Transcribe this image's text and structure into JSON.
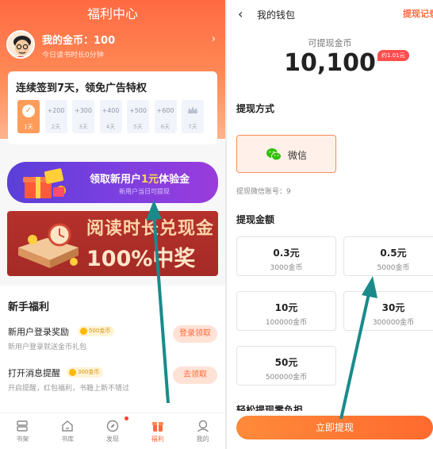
{
  "left": {
    "title": "福利中心",
    "user": {
      "coins_label": "我的金币：100",
      "read_time": "今日读书时长0分钟"
    },
    "signin": {
      "title": "连续签到7天，领免广告特权",
      "days": [
        {
          "points": "",
          "label": "1天"
        },
        {
          "points": "+200",
          "label": "2天"
        },
        {
          "points": "+300",
          "label": "3天"
        },
        {
          "points": "+400",
          "label": "4天"
        },
        {
          "points": "+500",
          "label": "5天"
        },
        {
          "points": "+600",
          "label": "6天"
        },
        {
          "points": "",
          "label": "7天"
        }
      ]
    },
    "banner_trial": {
      "pre": "领取新用户",
      "amount": "1元",
      "post": "体验金",
      "sub": "新用户当日可提现"
    },
    "banner_read": {
      "line1": "阅读时长兑现金",
      "line2": "100%中奖"
    },
    "novice": {
      "title": "新手福利",
      "tasks": [
        {
          "name": "新用户登录奖励",
          "coins": "500金币",
          "desc": "新用户登录就送金币礼包",
          "button": "登录领取"
        },
        {
          "name": "打开消息提醒",
          "coins": "300金币",
          "desc": "开启提醒，红包福利，书籍上新不错过",
          "button": "去领取"
        }
      ]
    },
    "tabs": [
      {
        "label": "书架",
        "icon": "bookshelf-icon"
      },
      {
        "label": "书库",
        "icon": "library-icon"
      },
      {
        "label": "发现",
        "icon": "compass-icon"
      },
      {
        "label": "福利",
        "icon": "gift-icon"
      },
      {
        "label": "我的",
        "icon": "profile-icon"
      }
    ]
  },
  "right": {
    "title": "我的钱包",
    "record": "提现记录",
    "available_label": "可提现金币",
    "balance": "10,100",
    "approx": "约1.01元",
    "method_title": "提现方式",
    "method": "微信",
    "account": "提现微信账号：9",
    "amount_title": "提现金额",
    "amounts": [
      {
        "value": "0.3元",
        "coins": "3000金币"
      },
      {
        "value": "0.5元",
        "coins": "5000金币"
      },
      {
        "value": "10元",
        "coins": "100000金币"
      },
      {
        "value": "30元",
        "coins": "300000金币"
      },
      {
        "value": "50元",
        "coins": "500000金币"
      }
    ],
    "cutoff_text": "轻松提现零负担",
    "withdraw_button": "立即提现"
  },
  "colors": {
    "accent": "#ff6a3d",
    "arrow": "#1a8a8a",
    "trial_banner": "#6a3fdc"
  }
}
